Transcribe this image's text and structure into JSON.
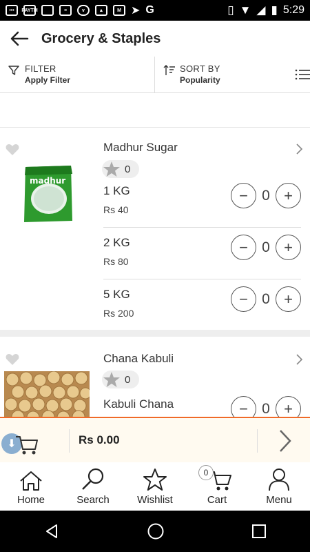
{
  "status_bar": {
    "time": "5:29",
    "paytm": "PAYTM"
  },
  "header": {
    "title": "Grocery & Staples"
  },
  "toolbar": {
    "filter_label": "FILTER",
    "filter_value": "Apply Filter",
    "sort_label": "SORT BY",
    "sort_value": "Popularity"
  },
  "products": [
    {
      "name": "Madhur Sugar",
      "rating_count": "0",
      "image_text": "madhur",
      "variants": [
        {
          "size": "1 KG",
          "price": "Rs 40",
          "qty": "0"
        },
        {
          "size": "2 KG",
          "price": "Rs 80",
          "qty": "0"
        },
        {
          "size": "5 KG",
          "price": "Rs 200",
          "qty": "0"
        }
      ]
    },
    {
      "name": "Chana Kabuli",
      "rating_count": "0",
      "variants": [
        {
          "size": "Kabuli Chana",
          "price": "",
          "qty": "0"
        }
      ]
    }
  ],
  "cart_bar": {
    "total": "Rs 0.00"
  },
  "bottom_nav": {
    "home": "Home",
    "search": "Search",
    "wishlist": "Wishlist",
    "cart": "Cart",
    "cart_badge": "0",
    "menu": "Menu"
  },
  "colors": {
    "accent": "#f06a28",
    "cart_bar_bg": "#fffaf0"
  }
}
